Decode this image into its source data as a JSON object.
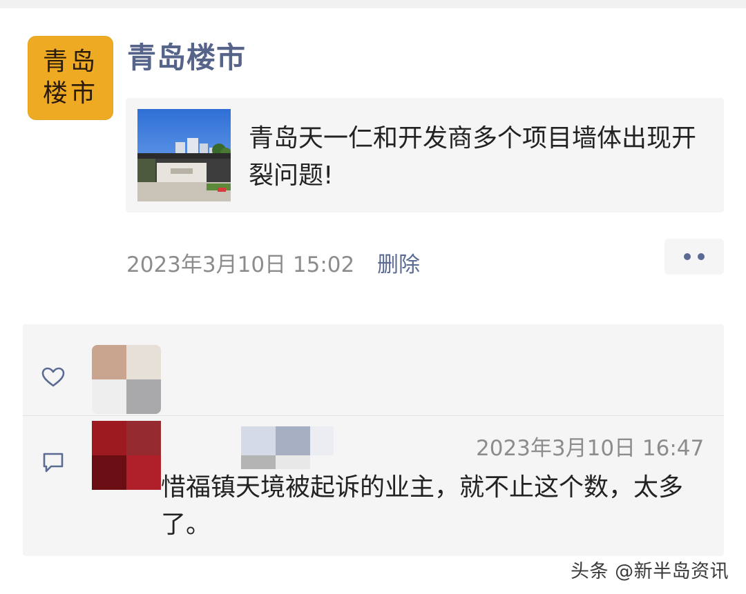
{
  "account": {
    "avatar_line1": "青岛",
    "avatar_line2": "楼市",
    "name": "青岛楼市"
  },
  "article": {
    "title": "青岛天一仁和开发商多个项目墙体出现开裂问题!"
  },
  "post": {
    "timestamp": "2023年3月10日 15:02",
    "delete_label": "删除"
  },
  "comment": {
    "time": "2023年3月10日 16:47",
    "text": "惜福镇天境被起诉的业主，就不止这个数，太多了。"
  },
  "watermark": "头条 @新半岛资讯",
  "icons": {
    "heart": "heart-icon",
    "comment": "comment-icon",
    "more": "more-dots-icon"
  },
  "colors": {
    "avatar_bg": "#eeaa22",
    "link": "#5a6a92",
    "panel_bg": "#f5f5f5",
    "meta_text": "#8c8c8c"
  }
}
